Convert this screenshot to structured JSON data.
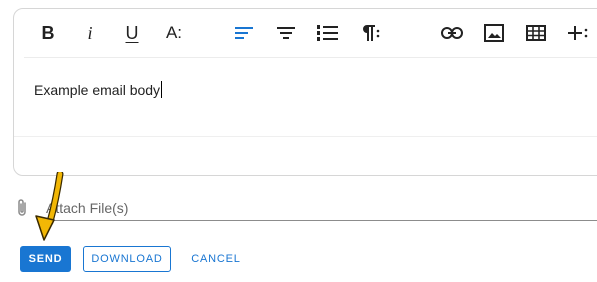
{
  "toolbar": {
    "bold": "B",
    "italic": "i",
    "underline": "U",
    "font_size": "A:",
    "active_color": "#1976d2"
  },
  "editor": {
    "body": "Example email body"
  },
  "attach": {
    "placeholder": "Attach File(s)"
  },
  "actions": {
    "send": "SEND",
    "download": "DOWNLOAD",
    "cancel": "CANCEL"
  },
  "colors": {
    "primary": "#1976d2",
    "annotation_arrow": "#f2b705"
  }
}
